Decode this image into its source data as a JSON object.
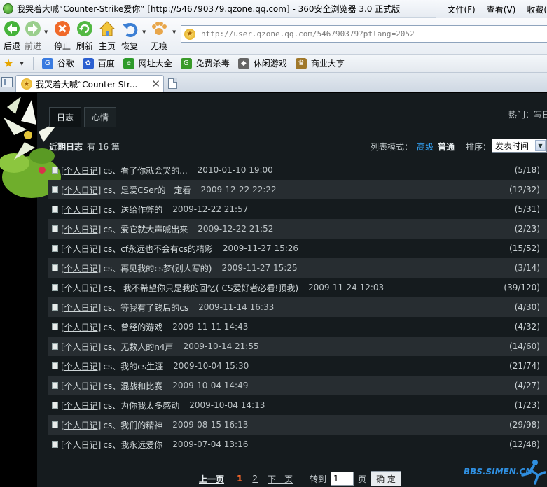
{
  "window": {
    "title": "我哭着大喊“Counter-Strike爱你”  [http://546790379.qzone.qq.com] - 360安全浏览器 3.0 正式版",
    "menus": [
      "文件(F)",
      "查看(V)",
      "收藏("
    ]
  },
  "toolbar": {
    "back": "后退",
    "forward": "前进",
    "stop": "停止",
    "refresh": "刷新",
    "home": "主页",
    "restore": "恢复",
    "incognito": "无痕",
    "address": "http://user.qzone.qq.com/546790379?ptlang=2052"
  },
  "favorites": {
    "items": [
      {
        "label": "谷歌",
        "icon": "google-icon",
        "color": "#3a7be0"
      },
      {
        "label": "百度",
        "icon": "baidu-icon",
        "color": "#2b5fd0"
      },
      {
        "label": "网址大全",
        "icon": "ie-icon",
        "color": "#2e9a2a"
      },
      {
        "label": "免费杀毒",
        "icon": "shield-icon",
        "color": "#3a9a2a"
      },
      {
        "label": "休闲游戏",
        "icon": "gamepad-icon",
        "color": "#666666"
      },
      {
        "label": "商业大亨",
        "icon": "tycoon-icon",
        "color": "#a0782a"
      }
    ]
  },
  "tabs": [
    {
      "title": "我哭着大喊“Counter-Str..."
    }
  ],
  "page": {
    "tabs": [
      "日志",
      "心情"
    ],
    "hot": "热门：写日",
    "recent_title": "近期日志",
    "recent_count": "有 16 篇",
    "mode_label": "列表模式：",
    "mode_advanced": "高级",
    "mode_normal": "普通",
    "sort_label": "排序：",
    "sort_value": "发表时间"
  },
  "posts": [
    {
      "cat": "[个人日记]",
      "title": "cs、看了你就会哭的...",
      "date": "2010-01-10 19:00",
      "count": "(5/18)"
    },
    {
      "cat": "[个人日记]",
      "title": "cs、是爱CSer的一定看",
      "date": "2009-12-22 22:22",
      "count": "(12/32)"
    },
    {
      "cat": "[个人日记]",
      "title": "cs、送给作弊的",
      "date": "2009-12-22 21:57",
      "count": "(5/31)"
    },
    {
      "cat": "[个人日记]",
      "title": "cs、爱它就大声喊出来",
      "date": "2009-12-22 21:52",
      "count": "(2/23)"
    },
    {
      "cat": "[个人日记]",
      "title": "cs、cf永远也不会有cs的精彩",
      "date": "2009-11-27 15:26",
      "count": "(15/52)"
    },
    {
      "cat": "[个人日记]",
      "title": "cs、再见我的cs梦(别人写的)",
      "date": "2009-11-27 15:25",
      "count": "(3/14)"
    },
    {
      "cat": "[个人日记]",
      "title": "cs、 我不希望你只是我的回忆( CS爱好者必看!顶我)",
      "date": "2009-11-24 12:03",
      "count": "(39/120)"
    },
    {
      "cat": "[个人日记]",
      "title": "cs、等我有了钱后的cs",
      "date": "2009-11-14 16:33",
      "count": "(4/30)"
    },
    {
      "cat": "[个人日记]",
      "title": "cs、曾经的游戏",
      "date": "2009-11-11 14:43",
      "count": "(4/32)"
    },
    {
      "cat": "[个人日记]",
      "title": "cs、无数人的n4声",
      "date": "2009-10-14 21:55",
      "count": "(14/60)"
    },
    {
      "cat": "[个人日记]",
      "title": "cs、我的cs生涯",
      "date": "2009-10-04 15:30",
      "count": "(21/74)"
    },
    {
      "cat": "[个人日记]",
      "title": "cs、混战和比赛",
      "date": "2009-10-04 14:49",
      "count": "(4/27)"
    },
    {
      "cat": "[个人日记]",
      "title": "cs、为你我太多感动",
      "date": "2009-10-04 14:13",
      "count": "(1/23)"
    },
    {
      "cat": "[个人日记]",
      "title": "cs、我们的精神",
      "date": "2009-08-15 16:13",
      "count": "(29/98)"
    },
    {
      "cat": "[个人日记]",
      "title": "cs、我永远爱你",
      "date": "2009-07-04 13:16",
      "count": "(12/48)"
    }
  ],
  "pager": {
    "prev": "上一页",
    "current": "1",
    "page2": "2",
    "next": "下一页",
    "goto": "转到",
    "input_value": "1",
    "page_unit": "页",
    "confirm": "确 定"
  },
  "watermark": "BBS.SIMEN.CN"
}
